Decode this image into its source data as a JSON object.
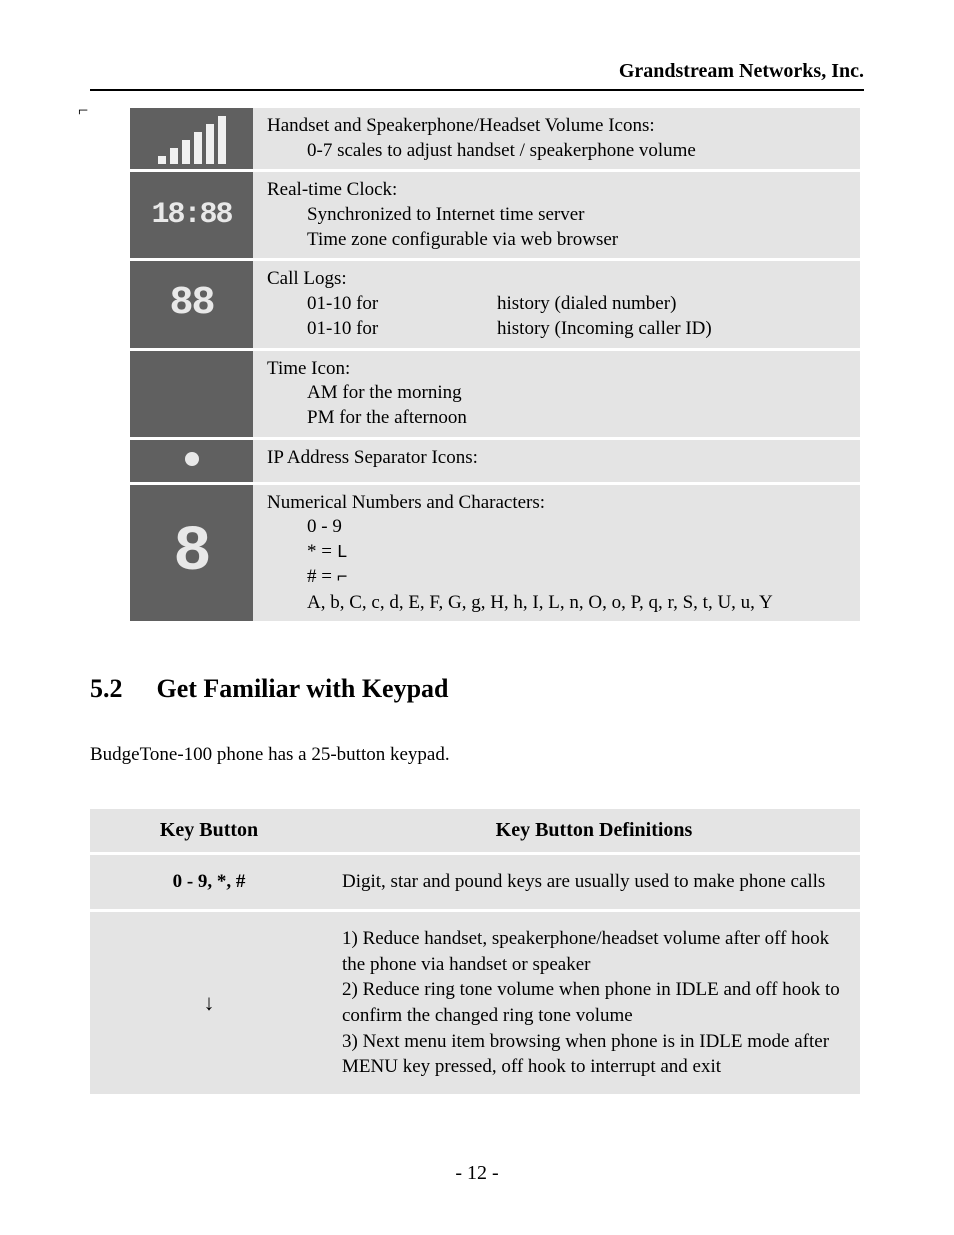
{
  "header": {
    "company": "Grandstream Networks, Inc."
  },
  "icon_rows": [
    {
      "icon_name": "volume-bars-icon",
      "title": "Handset and Speakerphone/Headset Volume Icons:",
      "line1": "0-7 scales to adjust handset / speakerphone volume"
    },
    {
      "icon_name": "clock-icon",
      "title": "Real-time Clock:",
      "line1": "Synchronized to Internet time server",
      "line2": "Time zone configurable via web browser"
    },
    {
      "icon_name": "call-log-icon",
      "title": "Call Logs:",
      "range_a": "01-10 for",
      "hist_a": "history (dialed number)",
      "range_b": "01-10 for",
      "hist_b": "history (Incoming caller ID)"
    },
    {
      "icon_name": "time-icon",
      "title": "Time Icon:",
      "line1": "AM for the morning",
      "line2": "PM for the afternoon"
    },
    {
      "icon_name": "ip-separator-icon",
      "title": "IP Address Separator Icons:"
    },
    {
      "icon_name": "numeric-char-icon",
      "title": "Numerical Numbers and Characters:",
      "line1": "0 - 9",
      "star_line": "* = ",
      "star_sym": "L",
      "hash_line": "# = ",
      "hash_sym": "⌐",
      "chars": "A, b, C, c, d, E, F, G, g,  H, h, I, L, n, O, o, P, q, r, S, t, U, u, Y"
    }
  ],
  "section": {
    "number": "5.2",
    "title": "Get Familiar with Keypad",
    "intro": "BudgeTone-100 phone has a 25-button keypad."
  },
  "key_table": {
    "head_a": "Key Button",
    "head_b": "Key Button Definitions",
    "rows": [
      {
        "key": "0 - 9, *, #",
        "def": "Digit, star and pound keys are usually used to make phone calls"
      },
      {
        "key": "↓",
        "def": "1) Reduce handset, speakerphone/headset volume after off hook the phone via handset or speaker\n2) Reduce ring tone volume when phone in IDLE and off hook to confirm the changed ring tone volume\n3) Next menu item browsing when phone is in IDLE mode after MENU key pressed, off hook to interrupt and exit"
      }
    ]
  },
  "page_number": "- 12 -"
}
